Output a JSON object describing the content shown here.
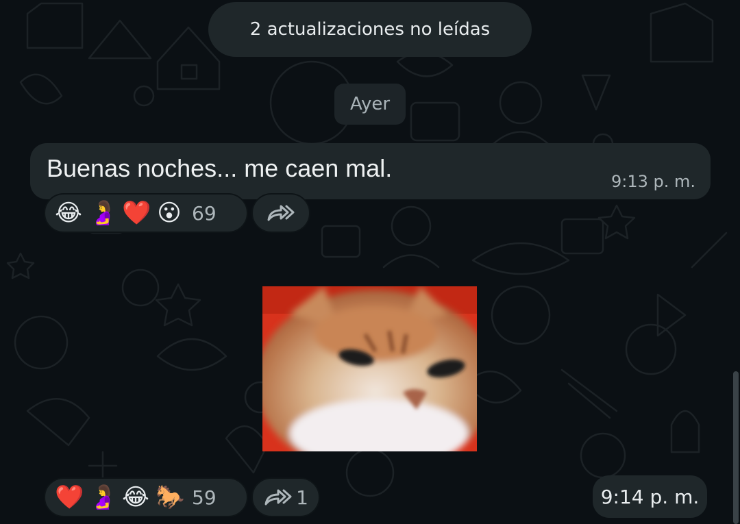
{
  "unread_banner": {
    "text": "2 actualizaciones no leídas"
  },
  "date_separator": {
    "text": "Ayer"
  },
  "messages": [
    {
      "text": "Buenas noches... me caen mal.",
      "time": "9:13 p. m.",
      "reactions": [
        "😂",
        "🤰",
        "❤️",
        "😮"
      ],
      "reaction_count": "69",
      "forward_count": ""
    },
    {
      "sticker": "blurry-cat-sticker",
      "time": "9:14 p. m.",
      "reactions": [
        "❤️",
        "🤰",
        "😂",
        "🐎"
      ],
      "reaction_count": "59",
      "forward_count": "1"
    }
  ],
  "icons": {
    "forward": "forward-arrow-icon"
  },
  "colors": {
    "background": "#0b1014",
    "bubble": "#1f272a",
    "text": "#e9edef",
    "secondary_text": "#aeb7bb"
  }
}
